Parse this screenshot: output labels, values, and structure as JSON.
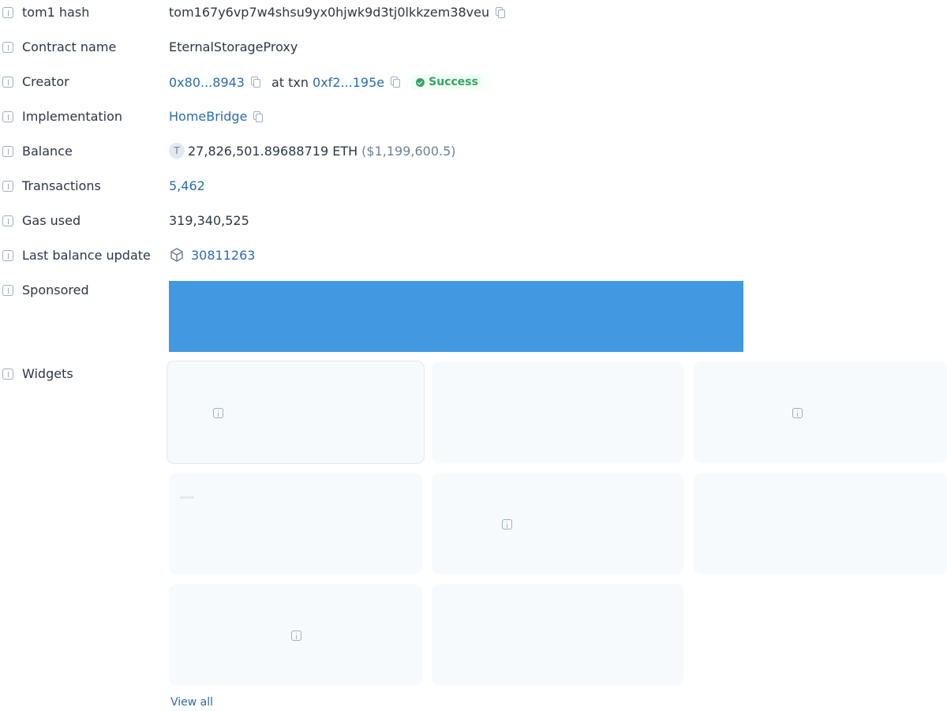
{
  "rows": {
    "hash": {
      "label": "tom1 hash",
      "value": "tom167y6vp7w4shsu9yx0hjwk9d3tj0lkkzem38veu"
    },
    "contract_name": {
      "label": "Contract name",
      "value": "EternalStorageProxy"
    },
    "creator": {
      "label": "Creator",
      "address": "0x80...8943",
      "at_txn_text": "at txn",
      "txn": "0xf2...195e",
      "status": "Success"
    },
    "implementation": {
      "label": "Implementation",
      "value": "HomeBridge"
    },
    "balance": {
      "label": "Balance",
      "token_letter": "T",
      "amount": "27,826,501.89688719 ETH",
      "usd": "($1,199,600.5)"
    },
    "transactions": {
      "label": "Transactions",
      "value": "5,462"
    },
    "gas_used": {
      "label": "Gas used",
      "value": "319,340,525"
    },
    "last_balance_update": {
      "label": "Last balance update",
      "value": "30811263",
      "icon": "block-cube-icon"
    },
    "sponsored": {
      "label": "Sponsored",
      "banner_color": "#4299e1"
    },
    "widgets": {
      "label": "Widgets",
      "view_all": "View all"
    }
  },
  "colors": {
    "link": "#2b6cb0",
    "success": "#38a169",
    "success_bg": "#f0fff4",
    "widget_bg": "#f7fafc"
  }
}
